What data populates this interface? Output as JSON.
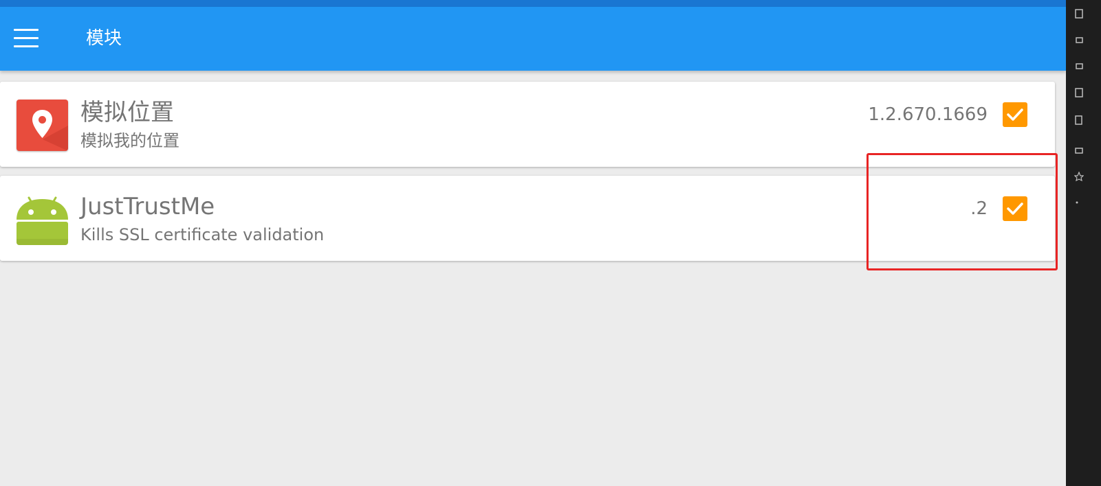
{
  "appbar": {
    "title": "模块",
    "menu_icon": "hamburger-menu-icon"
  },
  "modules": [
    {
      "icon": "location-pin-icon",
      "icon_color": "#e84c3d",
      "title": "模拟位置",
      "description": "模拟我的位置",
      "version": "1.2.670.1669",
      "enabled": true
    },
    {
      "icon": "android-robot-icon",
      "icon_color": "#a4c639",
      "title": "JustTrustMe",
      "description": "Kills SSL certificate validation",
      "version": ".2",
      "enabled": true
    }
  ],
  "colors": {
    "appbar": "#2196f3",
    "status_strip": "#1976d2",
    "checkbox": "#ff9800",
    "highlight": "#e82424",
    "background": "#ececec"
  }
}
